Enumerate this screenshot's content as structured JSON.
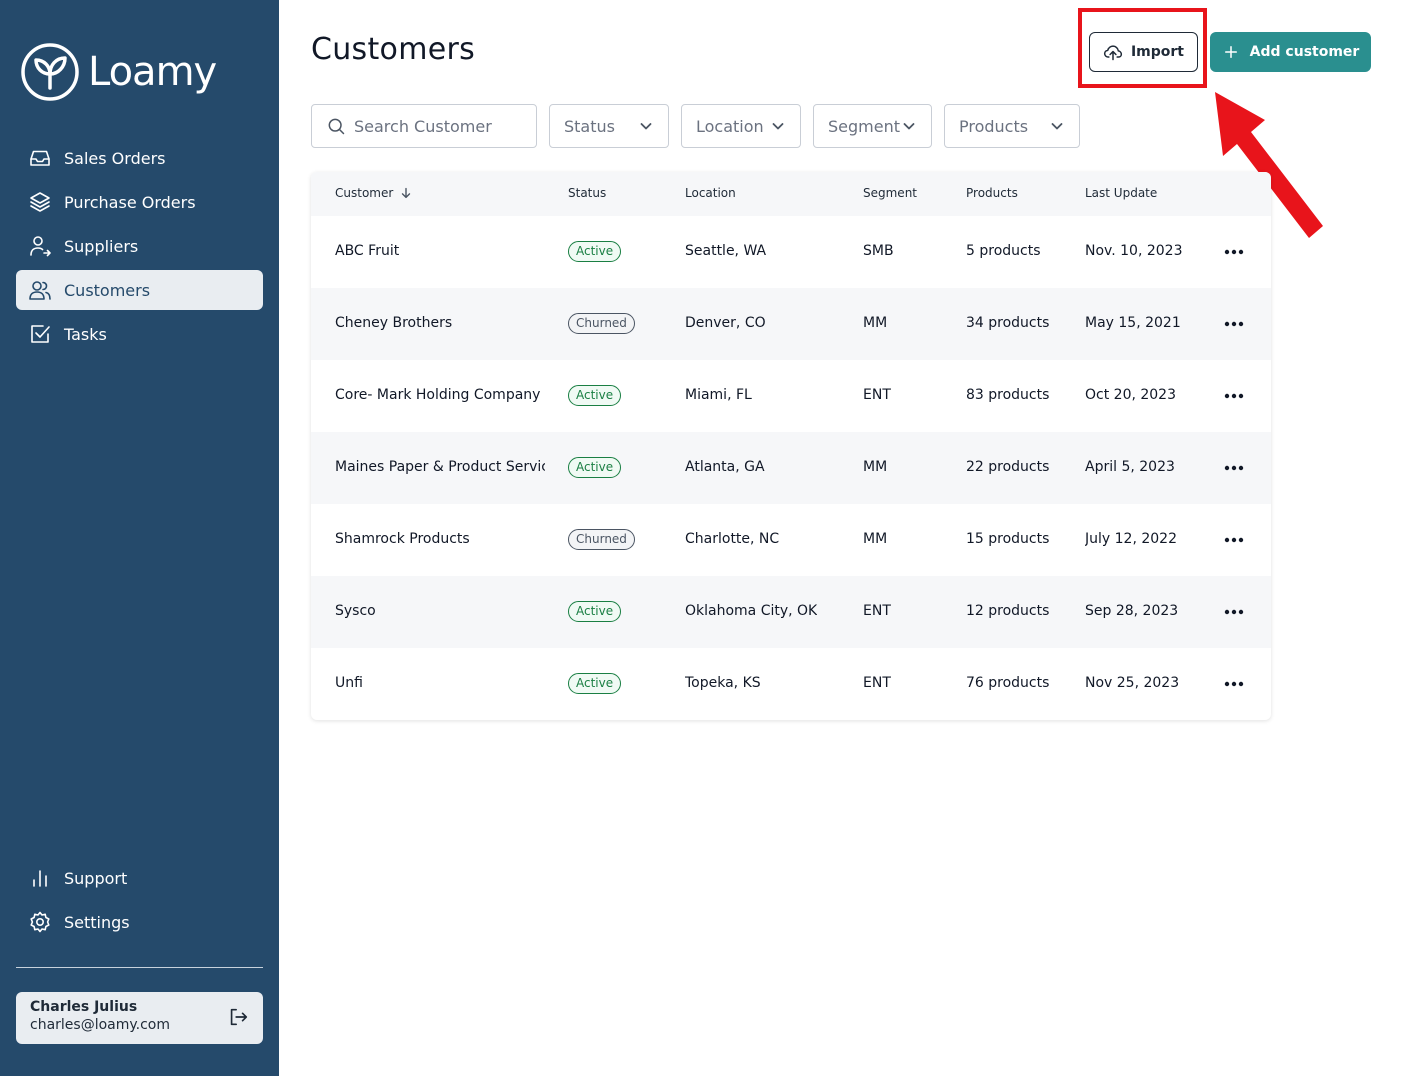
{
  "app": {
    "brand": "Loamy"
  },
  "sidebar": {
    "nav": [
      {
        "label": "Sales Orders",
        "icon": "inbox-icon"
      },
      {
        "label": "Purchase Orders",
        "icon": "layers-icon"
      },
      {
        "label": "Suppliers",
        "icon": "user-arrow-icon"
      },
      {
        "label": "Customers",
        "icon": "users-icon",
        "active": true
      },
      {
        "label": "Tasks",
        "icon": "checkbox-icon"
      }
    ],
    "bottom": [
      {
        "label": "Support",
        "icon": "bar-chart-icon"
      },
      {
        "label": "Settings",
        "icon": "gear-icon"
      }
    ],
    "user": {
      "name": "Charles Julius",
      "email": "charles@loamy.com"
    }
  },
  "header": {
    "title": "Customers",
    "import_label": "Import",
    "add_label": "Add customer"
  },
  "filters": {
    "search_placeholder": "Search Customer",
    "status": "Status",
    "location": "Location",
    "segment": "Segment",
    "products": "Products"
  },
  "table": {
    "columns": [
      "Customer",
      "Status",
      "Location",
      "Segment",
      "Products",
      "Last Update"
    ],
    "rows": [
      {
        "customer": "ABC Fruit",
        "status": "Active",
        "location": "Seattle, WA",
        "segment": "SMB",
        "products": "5 products",
        "last_update": "Nov. 10, 2023"
      },
      {
        "customer": "Cheney Brothers",
        "status": "Churned",
        "location": "Denver, CO",
        "segment": "MM",
        "products": "34 products",
        "last_update": "May 15, 2021"
      },
      {
        "customer": "Core- Mark Holding Company",
        "status": "Active",
        "location": "Miami, FL",
        "segment": "ENT",
        "products": "83 products",
        "last_update": "Oct 20, 2023"
      },
      {
        "customer": "Maines Paper & Product Service",
        "status": "Active",
        "location": "Atlanta, GA",
        "segment": "MM",
        "products": "22 products",
        "last_update": "April 5, 2023"
      },
      {
        "customer": "Shamrock Products",
        "status": "Churned",
        "location": "Charlotte, NC",
        "segment": "MM",
        "products": "15 products",
        "last_update": "July 12, 2022"
      },
      {
        "customer": "Sysco",
        "status": "Active",
        "location": "Oklahoma City, OK",
        "segment": "ENT",
        "products": "12 products",
        "last_update": "Sep 28, 2023"
      },
      {
        "customer": "Unfi",
        "status": "Active",
        "location": "Topeka, KS",
        "segment": "ENT",
        "products": "76 products",
        "last_update": "Nov 25, 2023"
      }
    ]
  },
  "colors": {
    "sidebar": "#254a6b",
    "accent": "#2a8f8f",
    "highlight": "#e8141b",
    "active_badge": "#1a7f43"
  }
}
